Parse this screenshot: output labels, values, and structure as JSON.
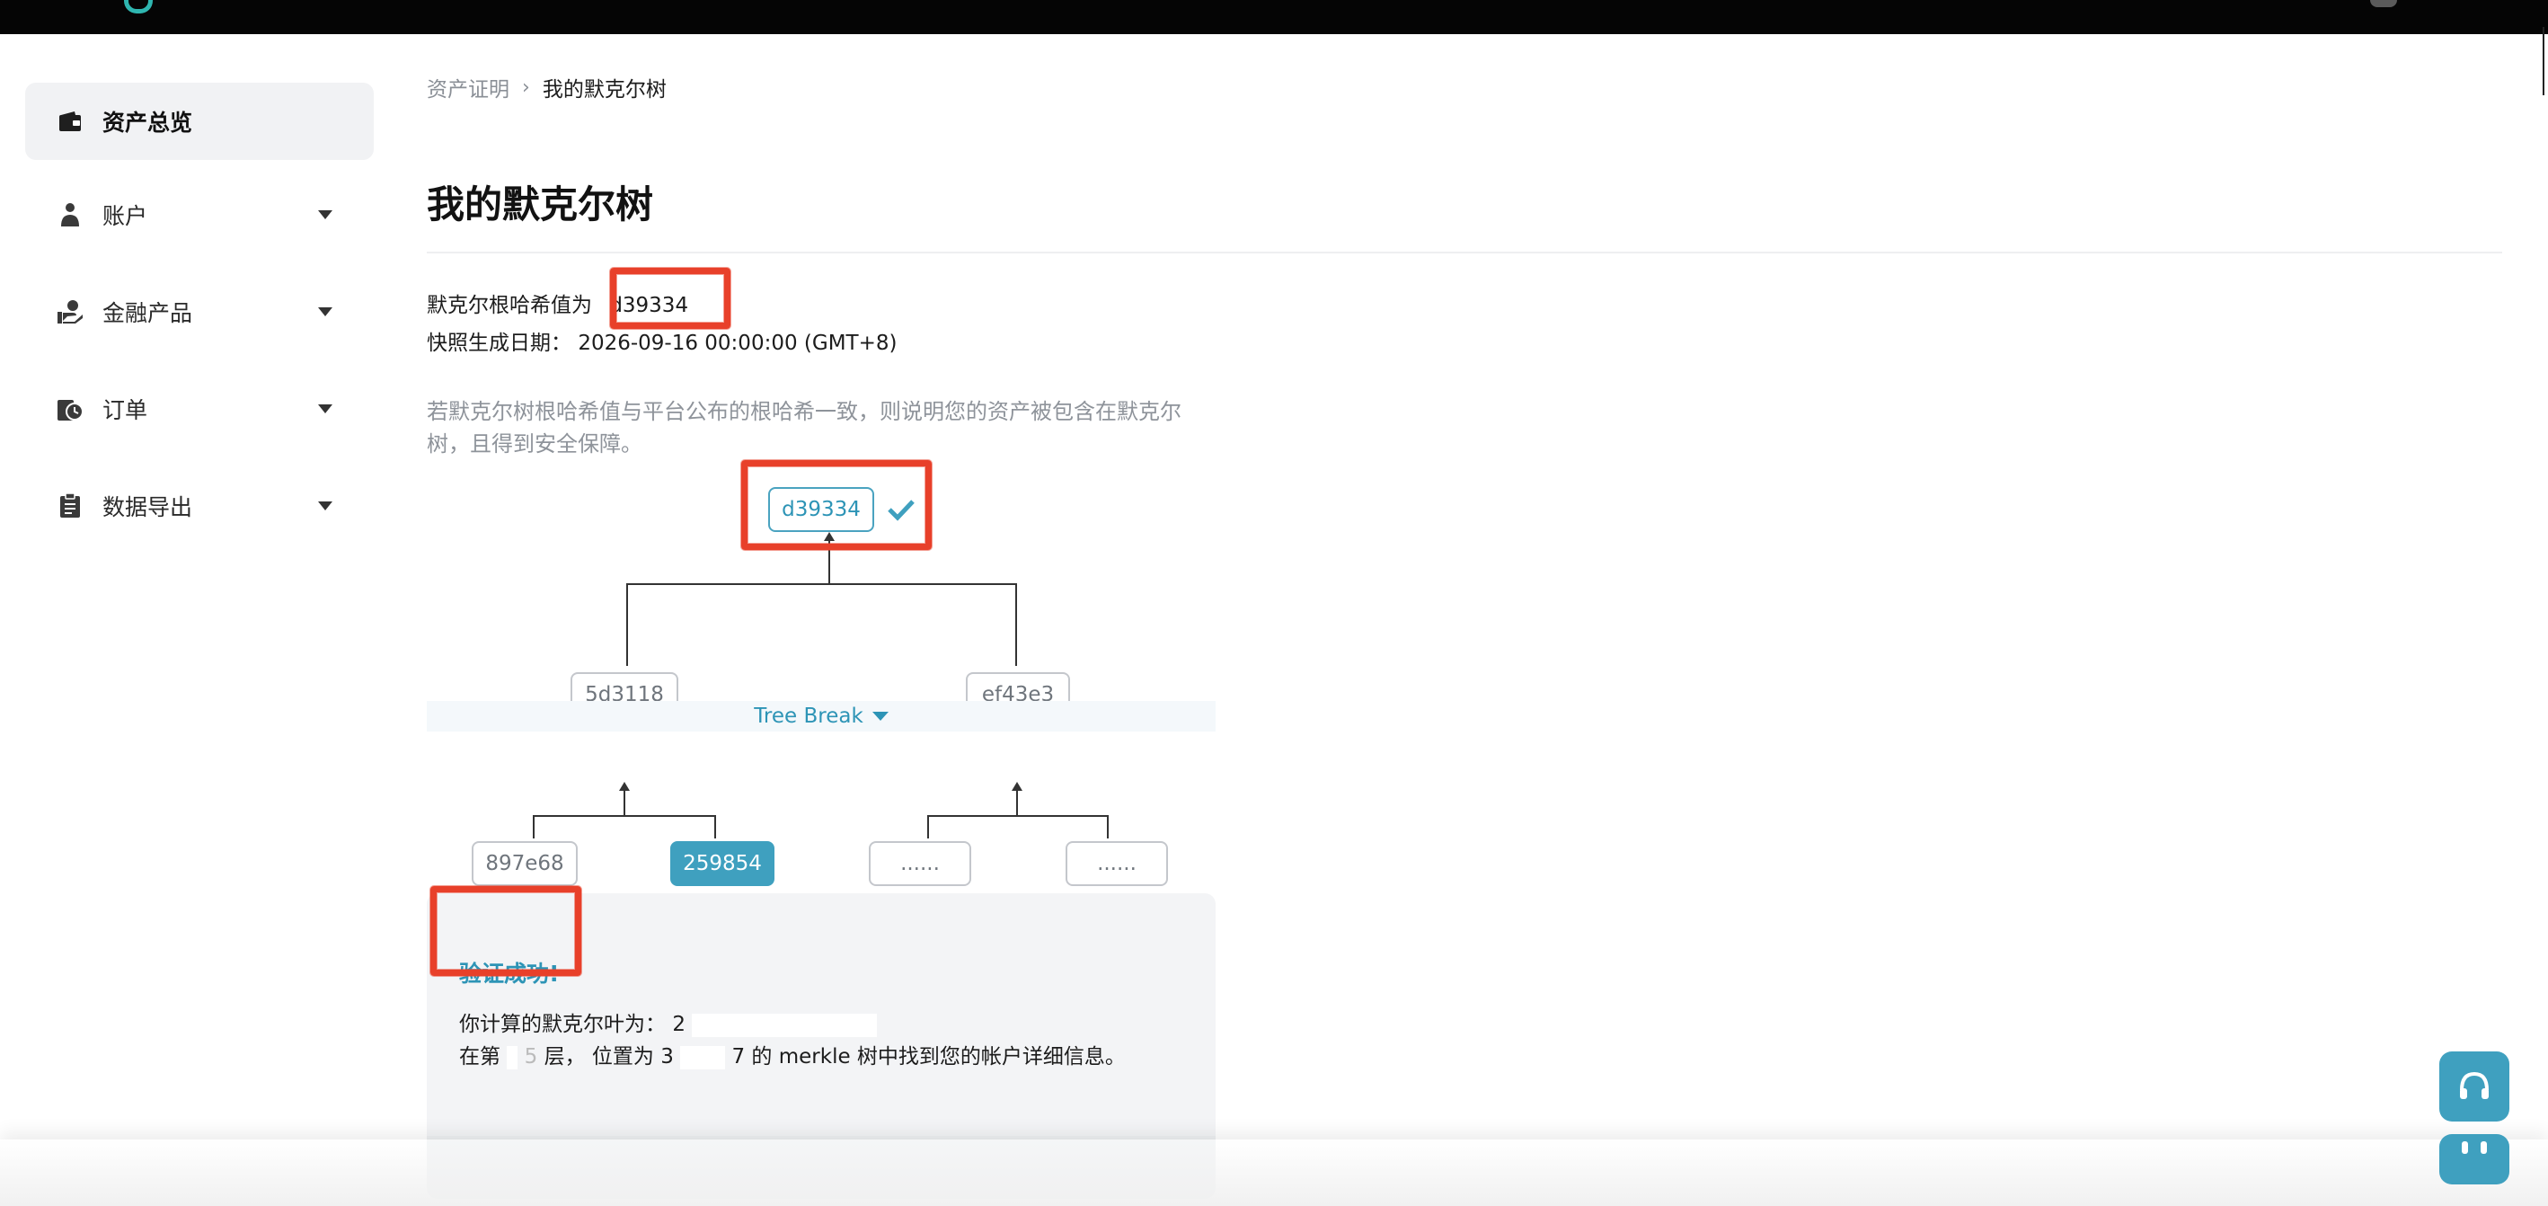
{
  "sidebar": {
    "items": [
      {
        "label": "资产总览",
        "icon": "wallet-icon",
        "active": true
      },
      {
        "label": "账户",
        "icon": "user-icon"
      },
      {
        "label": "金融产品",
        "icon": "finance-hand-icon"
      },
      {
        "label": "订单",
        "icon": "order-clock-icon"
      },
      {
        "label": "数据导出",
        "icon": "clipboard-icon"
      }
    ]
  },
  "breadcrumb": {
    "parent": "资产证明",
    "current": "我的默克尔树"
  },
  "page": {
    "title": "我的默克尔树",
    "root_hash_label": "默克尔根哈希值为",
    "root_hash_value": "d39334",
    "snapshot_label": "快照生成日期：",
    "snapshot_value": "2026-09-16 00:00:00 (GMT+8)",
    "hint": "若默克尔树根哈希值与平台公布的根哈希一致，则说明您的资产被包含在默克尔树，且得到安全保障。"
  },
  "tree": {
    "root": "d39334",
    "level1": [
      "5d3118",
      "ef43e3"
    ],
    "tree_break_label": "Tree Break",
    "leaves": [
      "897e68",
      "259854",
      "......",
      "......"
    ]
  },
  "result": {
    "success": "验证成功!",
    "leaf_label": "你计算的默克尔叶为：",
    "leaf_value": "2",
    "pos_prefix": "在第",
    "pos_layer": "5",
    "pos_mid": "层， 位置为",
    "pos_index_start": "3",
    "pos_index_end": "7",
    "pos_suffix": "的 merkle 树中找到您的帐户详细信息。"
  },
  "colors": {
    "accent": "#3fa0bf",
    "annotation": "#e8402a",
    "topbar": "#050505"
  }
}
